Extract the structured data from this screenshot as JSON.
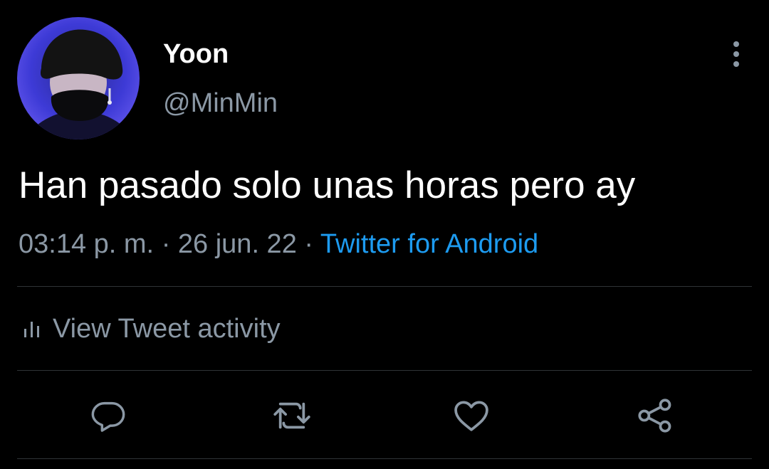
{
  "tweet": {
    "display_name": "Yoon",
    "handle": "@MinMin",
    "text": "Han pasado solo unas horas pero ay",
    "time": "03:14 p. m.",
    "separator": "·",
    "date": "26 jun. 22",
    "source": "Twitter for Android"
  },
  "activity": {
    "label": "View Tweet activity",
    "icon": "bar-chart-icon"
  },
  "actions": {
    "reply_icon": "reply-icon",
    "retweet_icon": "retweet-icon",
    "like_icon": "heart-icon",
    "share_icon": "share-icon"
  },
  "colors": {
    "background": "#000000",
    "text_primary": "#ffffff",
    "text_secondary": "#8b98a5",
    "accent": "#1d9bf0",
    "divider": "#2f3336"
  }
}
